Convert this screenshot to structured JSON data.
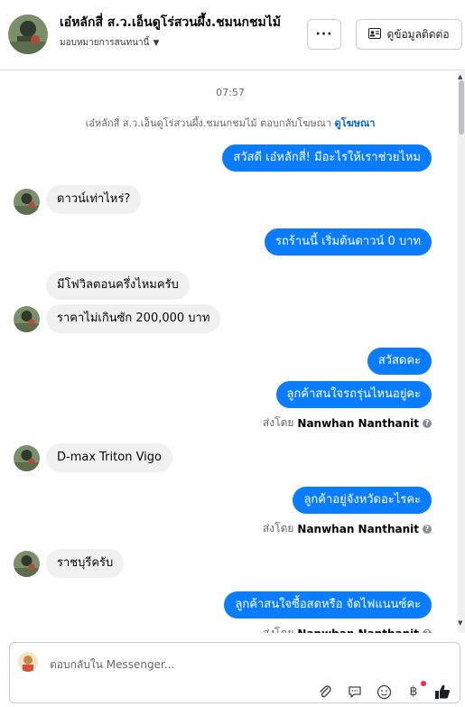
{
  "header": {
    "page_name": "เอ๋หลักสี่ ส.ว.เอ็นดูโร่สวนผึ้ง.ชมนกชมไม้",
    "assign_label": "มอบหมายการสนทนานี้",
    "more_label": "···",
    "contact_label": "ดูข้อมูลติดต่อ"
  },
  "thread": {
    "timestamp": "07:57",
    "system_prefix": "เอ๋หลักสี่ ส.ว.เอ็นดูโร่สวนผึ้ง.ชมนกชมไม้ ตอบกลับโฆษณา",
    "system_link": "ดูโฆษณา",
    "messages": [
      {
        "dir": "out",
        "text": "สวัสดี เอ๋หลักสี่! มีอะไรให้เราช่วยไหม"
      },
      {
        "dir": "in",
        "text": "ดาวน์เท่าไหร่?"
      },
      {
        "dir": "out",
        "text": "รถร้านนี้ เริ่มต้นดาวน์ 0 บาท"
      },
      {
        "dir": "in",
        "text": "มีโฟวิลตอนครึ่งไหมครับ"
      },
      {
        "dir": "in",
        "text": "ราคาไม่เกินซัก 200,000 บาท"
      },
      {
        "dir": "out",
        "text": "สวัสดคะ"
      },
      {
        "dir": "out",
        "text": "ลูกค้าสนใจรถรุ่นไหนอยู่คะ"
      },
      {
        "dir": "in",
        "text": "D-max Triton Vigo"
      },
      {
        "dir": "out",
        "text": "ลูกค้าอยู่จังหวัดอะไรคะ"
      },
      {
        "dir": "in",
        "text": "ราชบุรีครับ"
      },
      {
        "dir": "out",
        "text": "ลูกค้าสนใจซื้อสดหรือ จัดไฟแนนซ์คะ"
      }
    ],
    "sent_by_prefix": "ส่งโดย",
    "sent_by_name": "Nanwhan Nanthanit"
  },
  "composer": {
    "placeholder": "ตอบกลับใน Messenger..."
  },
  "icons": {
    "attach": "paperclip-icon",
    "saved_reply": "chat-bubble-icon",
    "emoji": "smiley-icon",
    "payment": "baht-icon",
    "like": "thumbs-up-icon"
  },
  "colors": {
    "accent": "#0a7cff",
    "incoming_bubble": "#f0f0f0",
    "link": "#0064d1"
  }
}
